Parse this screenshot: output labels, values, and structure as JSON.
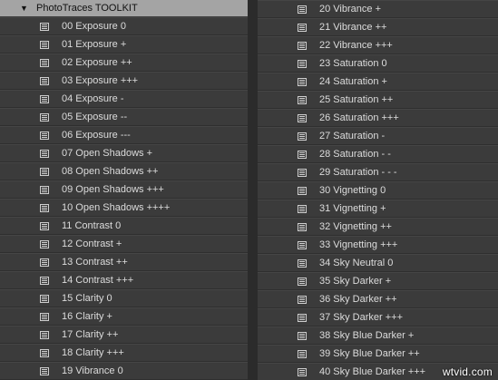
{
  "folder": {
    "name": "PhotoTraces TOOLKIT",
    "expanded_icon": "triangle-down-icon"
  },
  "left_presets": [
    "00 Exposure 0",
    "01 Exposure +",
    "02 Exposure ++",
    "03 Exposure +++",
    "04 Exposure -",
    "05 Exposure --",
    "06 Exposure ---",
    "07 Open Shadows +",
    "08 Open Shadows ++",
    "09 Open Shadows +++",
    "10 Open Shadows ++++",
    "11 Contrast 0",
    "12 Contrast +",
    "13 Contrast ++",
    "14 Contrast +++",
    "15 Clarity 0",
    "16 Clarity +",
    "17 Clarity ++",
    "18 Clarity +++",
    "19 Vibrance 0"
  ],
  "right_presets": [
    "20 Vibrance +",
    "21 Vibrance ++",
    "22 Vibrance +++",
    "23 Saturation 0",
    "24 Saturation +",
    "25 Saturation ++",
    "26 Saturation +++",
    "27 Saturation -",
    "28 Saturation - -",
    "29 Saturation - - -",
    "30 Vignetting 0",
    "31 Vignetting +",
    "32 Vignetting ++",
    "33 Vignetting +++",
    "34 Sky Neutral 0",
    "35 Sky Darker +",
    "36 Sky Darker ++",
    "37 Sky Darker +++",
    "38 Sky Blue Darker +",
    "39 Sky Blue Darker ++",
    "40 Sky Blue Darker +++"
  ],
  "watermark": "wtvid.com",
  "colors": {
    "panel": "#3b3b3b",
    "header": "#a4a4a4",
    "divider": "#2b2b2b",
    "text": "#dcdcdc"
  }
}
